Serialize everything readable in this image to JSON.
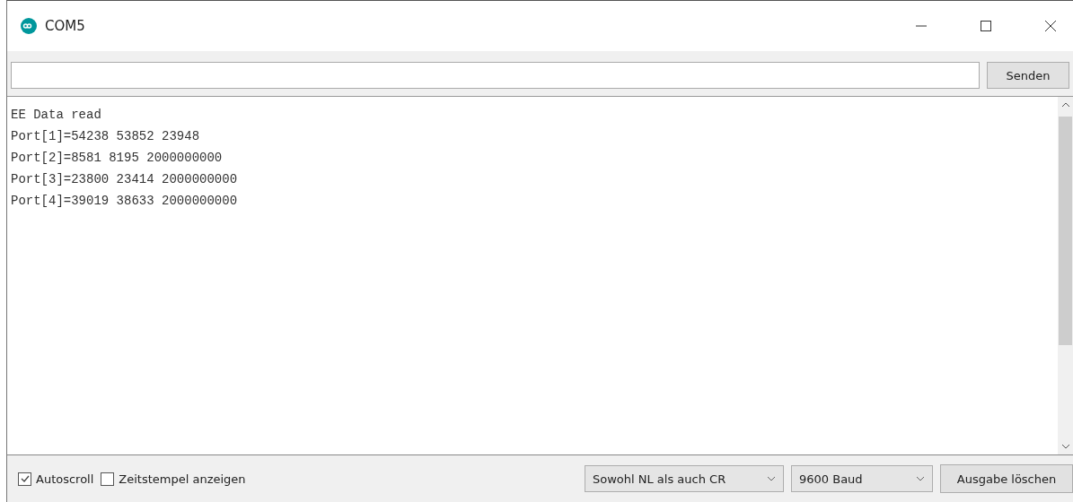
{
  "window": {
    "title": "COM5"
  },
  "send_button": "Senden",
  "output_lines": [
    "EE Data read",
    "Port[1]=54238 53852 23948",
    "Port[2]=8581 8195 2000000000",
    "Port[3]=23800 23414 2000000000",
    "Port[4]=39019 38633 2000000000"
  ],
  "options": [
    {
      "label": "Autoscroll",
      "checked": true
    },
    {
      "label": "Zeitstempel anzeigen",
      "checked": false
    }
  ],
  "line_ending": "Sowohl NL als auch CR",
  "baud_rate": "9600 Baud",
  "clear_button": "Ausgabe löschen"
}
